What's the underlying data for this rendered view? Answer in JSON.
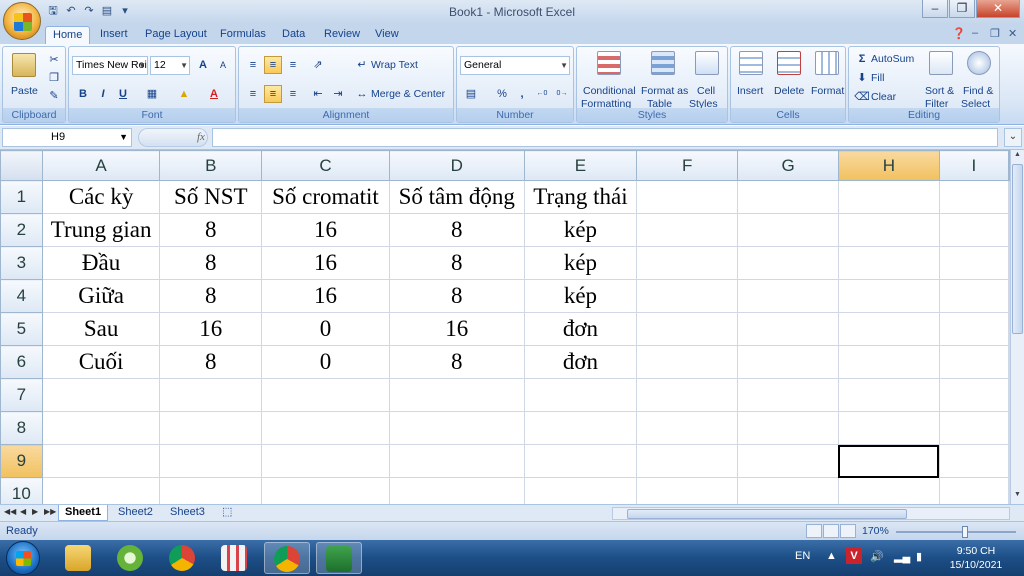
{
  "window": {
    "title": "Book1 - Microsoft Excel"
  },
  "tabs": [
    "Home",
    "Insert",
    "Page Layout",
    "Formulas",
    "Data",
    "Review",
    "View"
  ],
  "ribbon": {
    "clipboard": {
      "label": "Clipboard",
      "paste": "Paste"
    },
    "font": {
      "label": "Font",
      "font_name": "Times New Roi",
      "font_size": "12",
      "bold": "B",
      "italic": "I",
      "underline": "U",
      "grow": "A",
      "shrink": "A",
      "font_color": "A"
    },
    "alignment": {
      "label": "Alignment",
      "wrap_text": "Wrap Text",
      "merge_center": "Merge & Center"
    },
    "number": {
      "label": "Number",
      "format": "General",
      "percent": "%",
      "comma": ",",
      "inc_decimal": ".0→.00",
      "dec_decimal": ".00→.0"
    },
    "styles": {
      "label": "Styles",
      "conditional_1": "Conditional",
      "conditional_2": "Formatting",
      "format_table_1": "Format as",
      "format_table_2": "Table",
      "cell_styles_1": "Cell",
      "cell_styles_2": "Styles"
    },
    "cells": {
      "label": "Cells",
      "insert": "Insert",
      "delete": "Delete",
      "format": "Format"
    },
    "editing": {
      "label": "Editing",
      "autosum": "AutoSum",
      "fill": "Fill",
      "clear": "Clear",
      "sort_1": "Sort &",
      "sort_2": "Filter",
      "find_1": "Find &",
      "find_2": "Select"
    }
  },
  "formula_bar": {
    "name_box": "H9",
    "fx": "fx",
    "value": ""
  },
  "grid": {
    "columns": [
      "A",
      "B",
      "C",
      "D",
      "E",
      "F",
      "G",
      "H",
      "I"
    ],
    "selected_column": "H",
    "selected_row": 9,
    "rows": [
      {
        "n": "1",
        "cells": [
          "Các kỳ",
          "Số NST",
          "Số cromatit",
          "Số tâm động",
          "Trạng thái",
          "",
          "",
          "",
          ""
        ]
      },
      {
        "n": "2",
        "cells": [
          "Trung gian",
          "8",
          "16",
          "8",
          "kép",
          "",
          "",
          "",
          ""
        ]
      },
      {
        "n": "3",
        "cells": [
          "Đầu",
          "8",
          "16",
          "8",
          "kép",
          "",
          "",
          "",
          ""
        ]
      },
      {
        "n": "4",
        "cells": [
          "Giữa",
          "8",
          "16",
          "8",
          "kép",
          "",
          "",
          "",
          ""
        ]
      },
      {
        "n": "5",
        "cells": [
          "Sau",
          "16",
          "0",
          "16",
          "đơn",
          "",
          "",
          "",
          ""
        ]
      },
      {
        "n": "6",
        "cells": [
          "Cuối",
          "8",
          "0",
          "8",
          "đơn",
          "",
          "",
          "",
          ""
        ]
      },
      {
        "n": "7",
        "cells": [
          "",
          "",
          "",
          "",
          "",
          "",
          "",
          "",
          ""
        ]
      },
      {
        "n": "8",
        "cells": [
          "",
          "",
          "",
          "",
          "",
          "",
          "",
          "",
          ""
        ]
      },
      {
        "n": "9",
        "cells": [
          "",
          "",
          "",
          "",
          "",
          "",
          "",
          "",
          ""
        ]
      },
      {
        "n": "10",
        "cells": [
          "",
          "",
          "",
          "",
          "",
          "",
          "",
          "",
          ""
        ]
      }
    ]
  },
  "sheets": [
    "Sheet1",
    "Sheet2",
    "Sheet3"
  ],
  "active_sheet": "Sheet1",
  "status": {
    "ready": "Ready",
    "zoom": "170%"
  },
  "taskbar": {
    "language": "EN",
    "time": "9:50 CH",
    "date": "15/10/2021"
  },
  "colors": {
    "ribbon_text": "#15428b",
    "selected_header": "#f1c15f",
    "taskbar": "#1c4e86"
  }
}
